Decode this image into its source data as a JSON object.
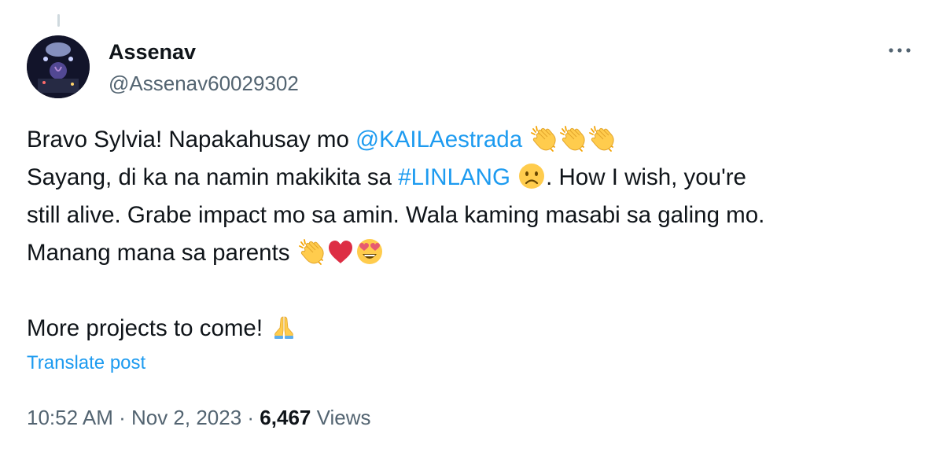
{
  "author": {
    "display_name": "Assenav",
    "handle": "@Assenav60029302"
  },
  "post": {
    "line1_prefix": "Bravo Sylvia! Napakahusay mo ",
    "mention": "@KAILAestrada",
    "line2_prefix": "Sayang, di ka na namin makikita sa ",
    "hashtag": "#LINLANG",
    "line2_suffix": ". How I wish, you're",
    "line3": "still alive. Grabe impact mo sa amin. Wala kaming masabi sa galing mo.",
    "line4": "Manang mana sa parents ",
    "line5": "More projects to come! ",
    "emojis": {
      "line1": [
        "clapping-hands",
        "clapping-hands",
        "clapping-hands"
      ],
      "line2": [
        "frowning-face"
      ],
      "line4": [
        "clapping-hands",
        "red-heart",
        "heart-eyes-face"
      ],
      "line5": [
        "folded-hands"
      ]
    }
  },
  "translate_label": "Translate post",
  "meta": {
    "time": "10:52 AM",
    "separator": " · ",
    "date": "Nov 2, 2023",
    "views_count": "6,467",
    "views_label": " Views"
  },
  "colors": {
    "accent": "#1d9bf0",
    "text": "#0f1419",
    "secondary": "#536471"
  },
  "icons": {
    "more": "more-horizontal-icon"
  }
}
